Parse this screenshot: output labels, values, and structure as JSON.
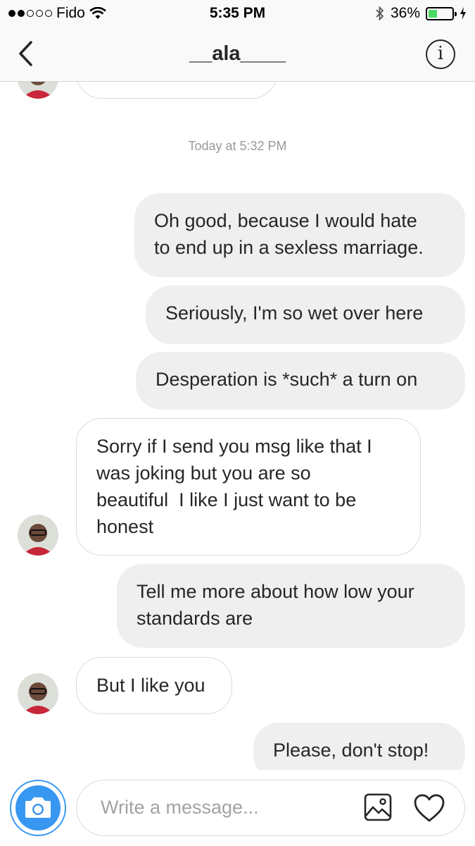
{
  "status_bar": {
    "carrier": "Fido",
    "time": "5:35 PM",
    "battery_percent": "36%",
    "battery_level": 0.36,
    "icons": [
      "signal-dots-icon",
      "wifi-icon",
      "bluetooth-icon",
      "battery-icon",
      "charging-bolt-icon"
    ]
  },
  "header": {
    "title": "__ala____",
    "back_icon": "chevron-left-icon",
    "info_label": "i"
  },
  "thread": {
    "timestamp": "Today at 5:32 PM",
    "messages": [
      {
        "direction": "received",
        "text": "",
        "partially_visible": true
      },
      {
        "direction": "sent",
        "text": "Oh good, because I would hate\nto end up in a sexless marriage."
      },
      {
        "direction": "sent",
        "text": "Seriously, I'm so wet over here"
      },
      {
        "direction": "sent",
        "text": "Desperation is *such* a turn on"
      },
      {
        "direction": "received",
        "text": "Sorry if I send you msg like that I\nwas joking but you are so\nbeautiful  I like I just want to be\nhonest"
      },
      {
        "direction": "sent",
        "text": "Tell me more about how low your\nstandards are"
      },
      {
        "direction": "received",
        "text": "But I like you"
      },
      {
        "direction": "sent",
        "text": "Please, don't stop!"
      }
    ]
  },
  "composer": {
    "placeholder": "Write a message...",
    "value": "",
    "icons": [
      "camera-icon",
      "gallery-icon",
      "heart-icon"
    ],
    "accent_color": "#3897f0"
  },
  "colors": {
    "sent_bubble": "#efefef",
    "received_border": "#dbdbdb",
    "timestamp_text": "#999999",
    "battery_fill": "#4cd964"
  }
}
